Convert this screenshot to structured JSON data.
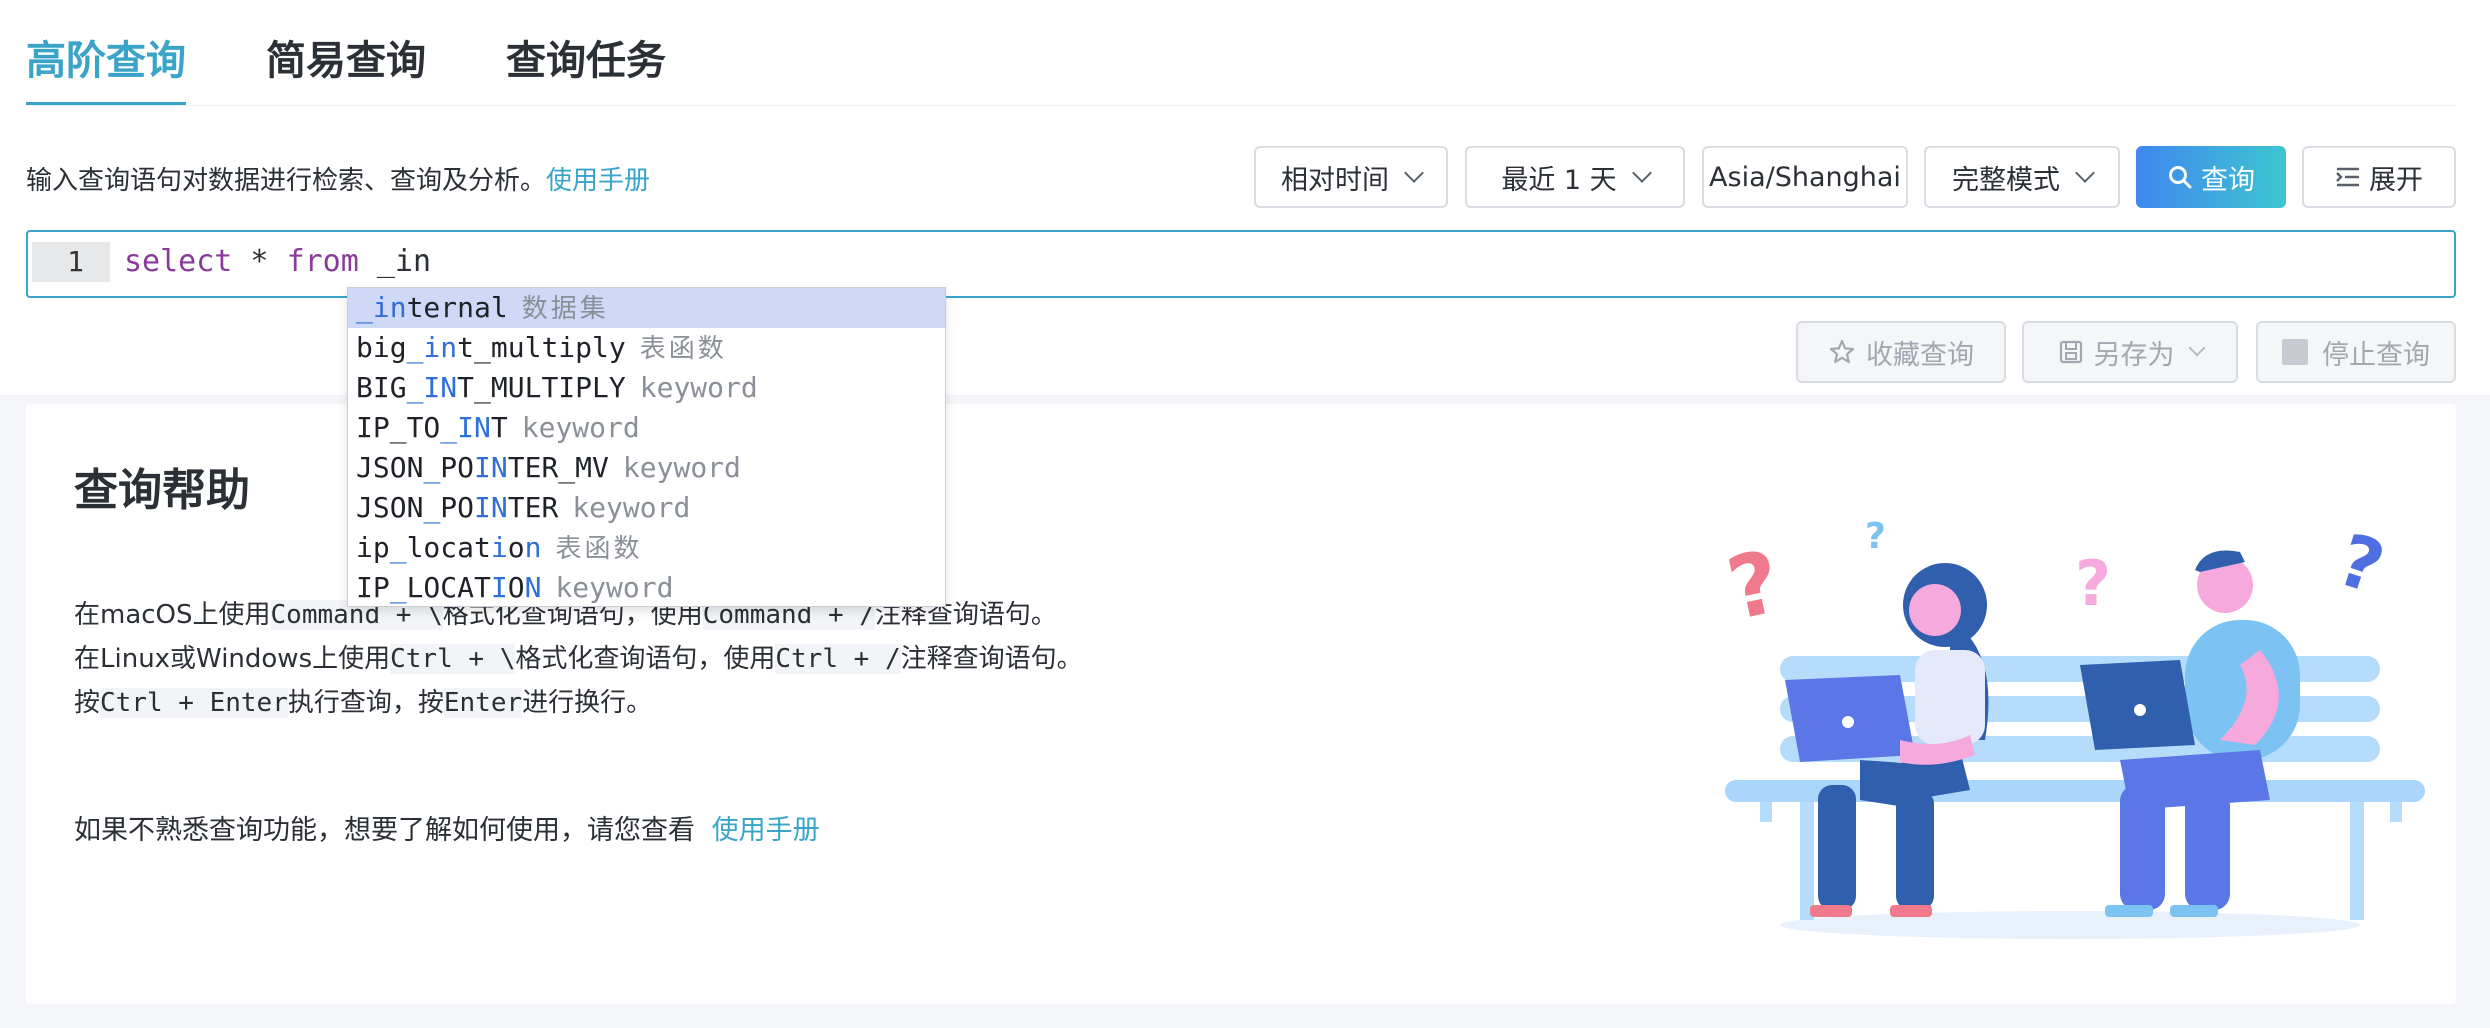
{
  "tabs": [
    {
      "label": "高阶查询"
    },
    {
      "label": "简易查询"
    },
    {
      "label": "查询任务"
    }
  ],
  "description": {
    "text": "输入查询语句对数据进行检索、查询及分析。",
    "manual_link": "使用手册"
  },
  "toolbar": {
    "time_type": "相对时间",
    "time_range": "最近 1 天",
    "timezone": "Asia/Shanghai",
    "mode": "完整模式",
    "query_button": "查询",
    "expand_button": "展开"
  },
  "editor": {
    "line_number": "1",
    "keyword_select": "select",
    "star": " * ",
    "keyword_from": "from",
    "typed": " _in"
  },
  "autocomplete": [
    {
      "pre": "",
      "m1": "_in",
      "mid": "",
      "m2": "",
      "post": "ternal",
      "type": "数据集"
    },
    {
      "pre": "big",
      "m1": "_in",
      "mid": "",
      "m2": "",
      "post": "t_multiply",
      "type": "表函数"
    },
    {
      "pre": "BIG",
      "m1": "_IN",
      "mid": "",
      "m2": "",
      "post": "T_MULTIPLY",
      "type": "keyword"
    },
    {
      "pre": "IP_TO",
      "m1": "_IN",
      "mid": "",
      "m2": "",
      "post": "T",
      "type": "keyword"
    },
    {
      "pre": "JSON",
      "m1": "_",
      "mid": "PO",
      "m2": "IN",
      "post": "TER_MV",
      "type": "keyword"
    },
    {
      "pre": "JSON",
      "m1": "_",
      "mid": "PO",
      "m2": "IN",
      "post": "TER",
      "type": "keyword"
    },
    {
      "pre": "ip",
      "m1": "_",
      "mid": "locat",
      "m2": "i",
      "post2": "o",
      "m3": "n",
      "type": "表函数"
    },
    {
      "pre": "IP",
      "m1": "_",
      "mid": "LOCAT",
      "m2": "I",
      "post2": "O",
      "m3": "N",
      "type": "keyword"
    }
  ],
  "actions": {
    "favorite": "收藏查询",
    "save_as": "另存为",
    "stop": "停止查询"
  },
  "help": {
    "title": "查询帮助",
    "line1": {
      "a": "在macOS上使用",
      "k1": "Command + \\",
      "b": "格式化查询语句，使用",
      "k2": "Command + /",
      "c": "注释查询语句。"
    },
    "line2": {
      "a": "在Linux或Windows上使用",
      "k1": "Ctrl + \\",
      "b": "格式化查询语句，使用",
      "k2": "Ctrl + /",
      "c": "注释查询语句。"
    },
    "line3": {
      "a": "按",
      "k1": "Ctrl + Enter",
      "b": "执行查询，按",
      "k2": "Enter",
      "c": "进行换行。"
    },
    "tip": "如果不熟悉查询功能，想要了解如何使用，请您查看",
    "tip_link": "使用手册"
  },
  "colors": {
    "accent": "#3aa4c8",
    "primary_start": "#3f87f0",
    "primary_end": "#3ec5cf"
  }
}
